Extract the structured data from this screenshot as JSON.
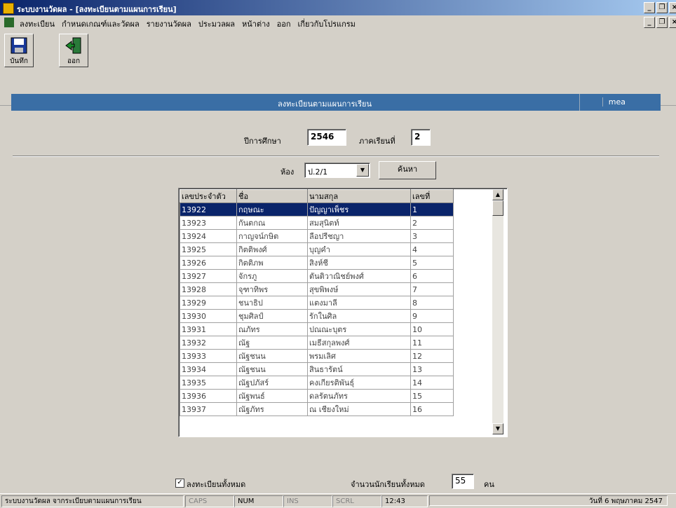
{
  "window": {
    "title": "ระบบงานวัดผล - [ลงทะเบียนตามแผนการเรียน]"
  },
  "menu": [
    "ลงทะเบียน",
    "กำหนดเกณฑ์และวัดผล",
    "รายงานวัดผล",
    "ประมวลผล",
    "หน้าต่าง",
    "ออก",
    "เกี่ยวกับโปรแกรม"
  ],
  "toolbar": {
    "save_label": "บันทึก",
    "exit_label": "ออก"
  },
  "header": {
    "title": "ลงทะเบียนตามแผนการเรียน",
    "user": "mea"
  },
  "form": {
    "year_label": "ปีการศึกษา",
    "year_value": "2546",
    "term_label": "ภาคเรียนที่",
    "term_value": "2",
    "room_label": "ห้อง",
    "room_value": "ป.2/1",
    "search_label": "ค้นหา"
  },
  "table": {
    "headers": [
      "เลขประจำตัว",
      "ชื่อ",
      "นามสกุล",
      "เลขที่"
    ],
    "rows": [
      [
        "13922",
        "กฤษณะ",
        "ปัญญาเพ็ชร",
        "1"
      ],
      [
        "13923",
        "กันตกณ",
        "สมสุนิตท์",
        "2"
      ],
      [
        "13924",
        "กาญจน์กษิต",
        "ลือปรีชญา",
        "3"
      ],
      [
        "13925",
        "กิตติพงศ์",
        "บุญคำ",
        "4"
      ],
      [
        "13926",
        "กิตติภพ",
        "สิงห์ชี",
        "5"
      ],
      [
        "13927",
        "จักรภู",
        "ตันติวาณิชย์พงศ์",
        "6"
      ],
      [
        "13928",
        "จุฑาทิพร",
        "สุขพิพงษ์",
        "7"
      ],
      [
        "13929",
        "ชนาธิป",
        "แตงมาลี",
        "8"
      ],
      [
        "13930",
        "ชุมศิลป์",
        "รักในศิล",
        "9"
      ],
      [
        "13931",
        "ณภัทร",
        "ปณณะบุตร",
        "10"
      ],
      [
        "13932",
        "ณัฐ",
        "เมธีสกุลพงศ์",
        "11"
      ],
      [
        "13933",
        "ณัฐชนน",
        "พรมเลิศ",
        "12"
      ],
      [
        "13934",
        "ณัฐชนน",
        "สินธารัตน์",
        "13"
      ],
      [
        "13935",
        "ณัฐปภัสร์",
        "คงเกียรติพันธุ์",
        "14"
      ],
      [
        "13936",
        "ณัฐพนธ์",
        "ดลรัตนภัทร",
        "15"
      ],
      [
        "13937",
        "ณัฐภัทร",
        "ณ เชียงใหม่",
        "16"
      ]
    ],
    "selected_index": 0
  },
  "footer": {
    "register_all_label": "ลงทะเบียนทั้งหมด",
    "register_all_checked": true,
    "total_label": "จำนวนนักเรียนทั้งหมด",
    "total_value": "55",
    "unit": "คน"
  },
  "statusbar": {
    "text": "ระบบงานวัดผล จากระเบียบตามแผนการเรียน",
    "caps": "CAPS",
    "num": "NUM",
    "ins": "INS",
    "scrl": "SCRL",
    "time": "12:43",
    "date": "วันที่ 6 พฤษภาคม 2547"
  }
}
